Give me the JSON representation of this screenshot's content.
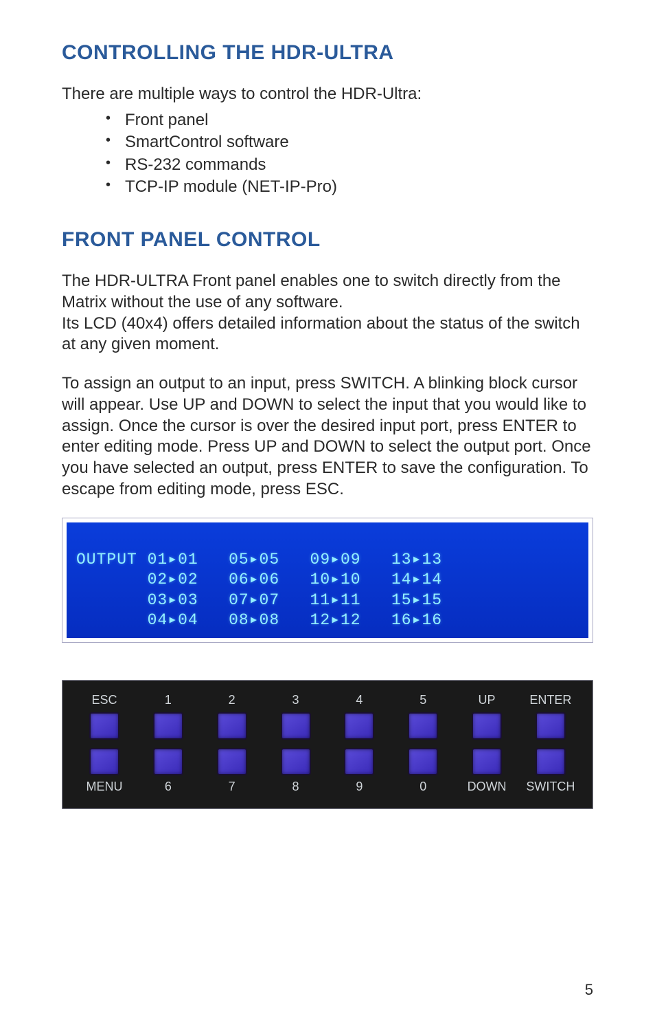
{
  "heading1": "CONTROLLING THE HDR-ULTRA",
  "intro": "There are multiple ways to control the HDR-Ultra:",
  "bullets": [
    "Front panel",
    "SmartControl software",
    "RS-232 commands",
    "TCP-IP module (NET-IP-Pro)"
  ],
  "heading2": "FRONT PANEL CONTROL",
  "para1": "The HDR-ULTRA Front panel enables one to switch directly from the Matrix without the use of any software.\nIts LCD (40x4) offers detailed information about the status of the switch at any given moment.",
  "para2": "To assign an output to an input, press SWITCH. A blinking block cursor will appear. Use UP and DOWN to select the input that you would like to assign. Once the cursor is over the desired input port, press ENTER to enter editing mode. Press UP and DOWN to select the output port. Once you have selected an output, press ENTER to save the configuration. To escape from editing mode, press ESC.",
  "lcd": {
    "line1": "OUTPUT 01▸01   05▸05   09▸09   13▸13",
    "line2": "       02▸02   06▸06   10▸10   14▸14",
    "line3": "       03▸03   07▸07   11▸11   15▸15",
    "line4": "       04▸04   08▸08   12▸12   16▸16"
  },
  "panel": {
    "topLabels": [
      "ESC",
      "1",
      "2",
      "3",
      "4",
      "5",
      "UP",
      "ENTER"
    ],
    "bottomLabels": [
      "MENU",
      "6",
      "7",
      "8",
      "9",
      "0",
      "DOWN",
      "SWITCH"
    ]
  },
  "pageNumber": "5"
}
